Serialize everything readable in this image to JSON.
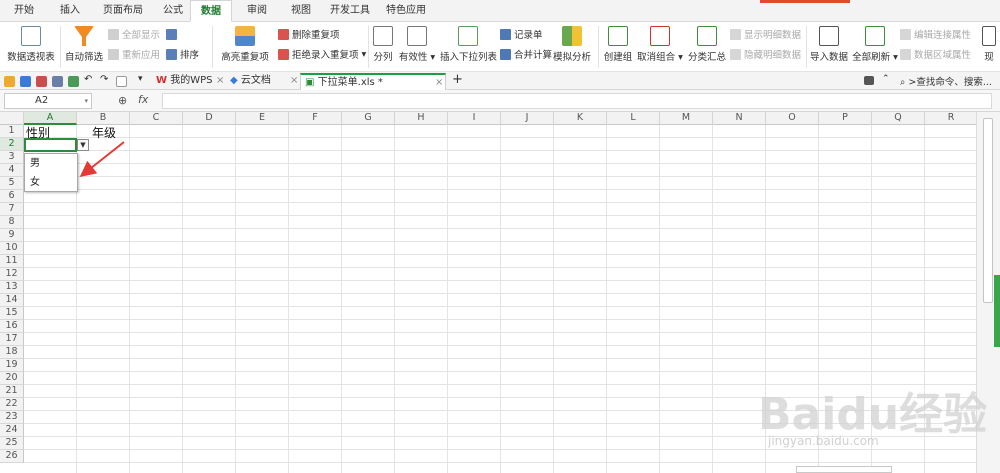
{
  "tabs": [
    "开始",
    "插入",
    "页面布局",
    "公式",
    "数据",
    "审阅",
    "视图",
    "开发工具",
    "特色应用"
  ],
  "active_tab": "数据",
  "ribbon": {
    "pivot": "数据透视表",
    "autofilter": "自动筛选",
    "show_all": "全部显示",
    "reapply": "重新应用",
    "sort": "排序",
    "highlight_dup": "高亮重复项",
    "delete_dup": "删除重复项",
    "reject_dup": "拒绝录入重复项",
    "split": "分列",
    "validity": "有效性",
    "insert_dropdown": "插入下拉列表",
    "records": "记录单",
    "consolidate": "合并计算",
    "simulate": "模拟分析",
    "group": "创建组",
    "ungroup": "取消组合",
    "subtotal": "分类汇总",
    "show_detail": "显示明细数据",
    "hide_detail": "隐藏明细数据",
    "import": "导入数据",
    "refresh_all": "全部刷新",
    "edit_links": "编辑连接属性",
    "range_props": "数据区域属性",
    "cut_off": "现"
  },
  "doc_tabs": [
    {
      "label": "我的WPS"
    },
    {
      "label": "云文档"
    },
    {
      "label": "下拉菜单.xls *"
    }
  ],
  "search_placeholder": ">查找命令、搜索...",
  "name_box": "A2",
  "fx_label": "fx",
  "columns": [
    "A",
    "B",
    "C",
    "D",
    "E",
    "F",
    "G",
    "H",
    "I",
    "J",
    "K",
    "L",
    "M",
    "N",
    "O",
    "P",
    "Q",
    "R"
  ],
  "rows": [
    "1",
    "2",
    "3",
    "4",
    "5",
    "6",
    "7",
    "8",
    "9",
    "10",
    "11",
    "12",
    "13",
    "14",
    "15",
    "16",
    "17",
    "18",
    "19",
    "20",
    "21",
    "22",
    "23",
    "24",
    "25",
    "26"
  ],
  "cells": {
    "A1": "性别",
    "B1": "年级"
  },
  "dropdown_options": [
    "男",
    "女"
  ],
  "watermark": {
    "main": "Baidu经验",
    "sub": "jingyan.baidu.com"
  },
  "colors": {
    "accent_green": "#2e8b3a",
    "arrow_red": "#e53935"
  }
}
